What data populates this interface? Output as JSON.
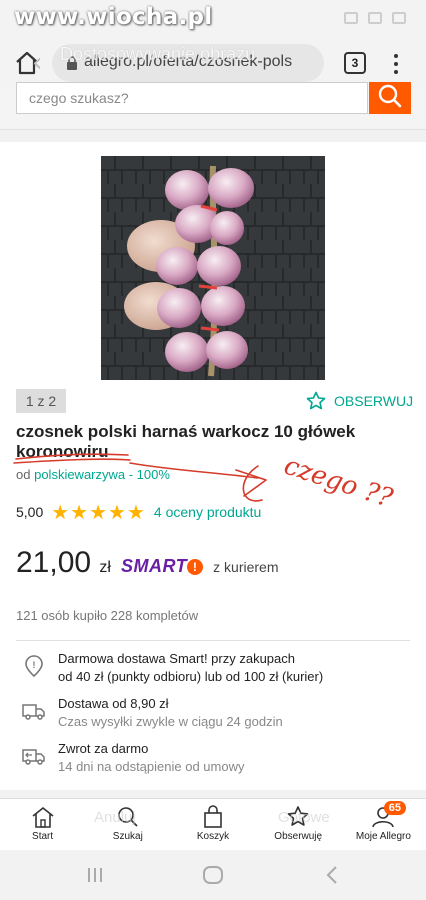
{
  "watermark": "www.wiocha.pl",
  "browser": {
    "url": "allegro.pl/oferta/czosnek-pols",
    "overlay_title": "Dostosowywanie obrazu",
    "tab_count": "3"
  },
  "search": {
    "placeholder": "czego szukasz?"
  },
  "gallery": {
    "counter": "1 z 2"
  },
  "watch_label": "OBSERWUJ",
  "product": {
    "title": "czosnek polski harnaś warkocz 10 główek koronowiru",
    "seller_prefix": "od",
    "seller_link": "polskiewarzywa - 100%",
    "rating_value": "5,00",
    "stars": "★★★★★",
    "rating_count": "4 oceny produktu",
    "price_main": "21,00",
    "price_currency": "zł",
    "smart_label": "SMART",
    "smart_mark": "!",
    "courier": "z kurierem",
    "sold": "121 osób kupiło 228 kompletów"
  },
  "annotation": {
    "handwriting": "czego ??"
  },
  "info": [
    {
      "icon": "location-pin-icon",
      "title": "Darmowa dostawa Smart! przy zakupach",
      "sub": "od 40 zł (punkty odbioru) lub od 100 zł (kurier)"
    },
    {
      "icon": "delivery-truck-icon",
      "title": "Dostawa od 8,90 zł",
      "sub": "Czas wysyłki zwykle w ciągu 24 godzin"
    },
    {
      "icon": "return-truck-icon",
      "title": "Zwrot za darmo",
      "sub": "14 dni na odstąpienie od umowy"
    }
  ],
  "bottom_nav": {
    "ghost_left": "Anuluj",
    "ghost_right": "Gotowe",
    "items": [
      {
        "label": "Start"
      },
      {
        "label": "Szukaj"
      },
      {
        "label": "Koszyk"
      },
      {
        "label": "Obserwuję"
      },
      {
        "label": "Moje Allegro",
        "badge": "65"
      }
    ]
  },
  "colors": {
    "accent": "#00a790",
    "brand": "#ff5a00",
    "smart": "#6a1ea6",
    "star": "#ffb300",
    "annotation": "#d63a2a"
  }
}
